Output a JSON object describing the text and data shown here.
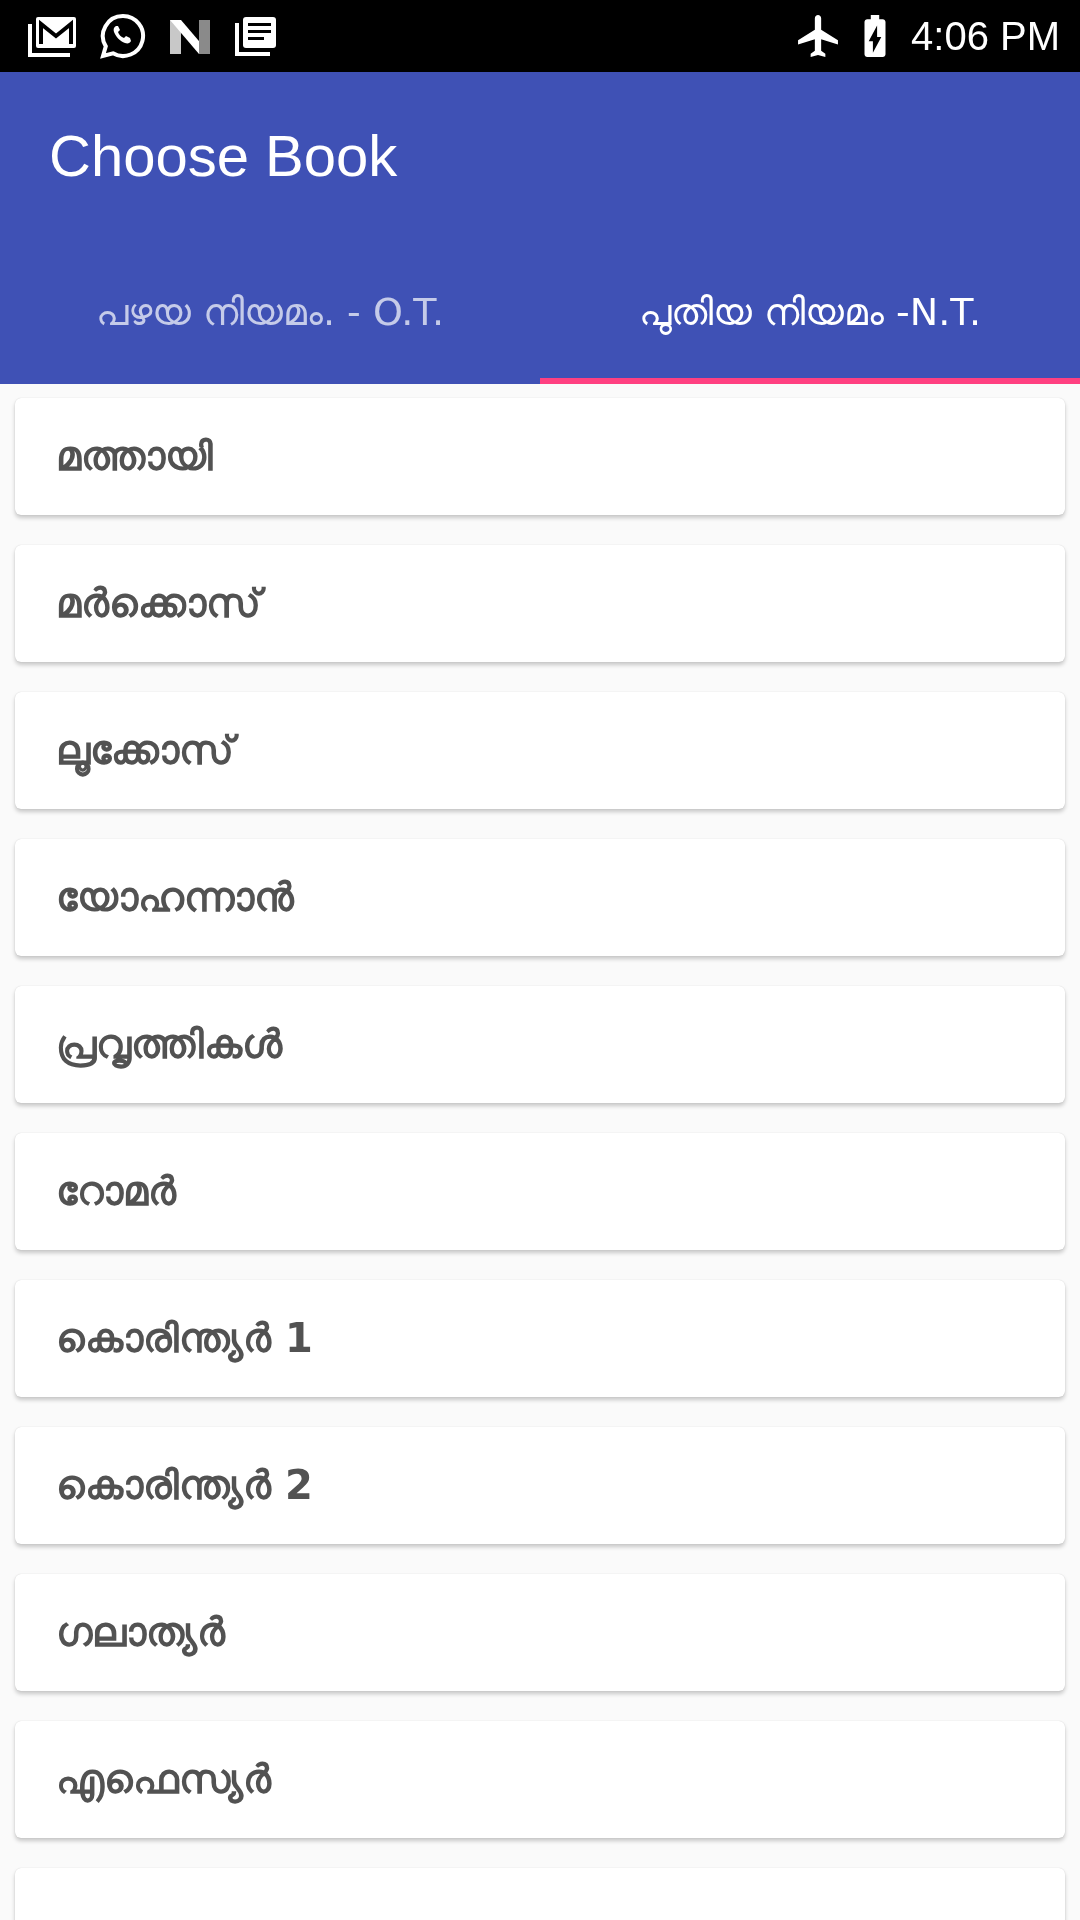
{
  "status_bar": {
    "notifications": [
      {
        "kind": "mail"
      },
      {
        "kind": "chat"
      },
      {
        "kind": "news"
      },
      {
        "kind": "document"
      }
    ],
    "airplane_mode": true,
    "battery_charging": true,
    "time": "4:06 PM"
  },
  "app_bar": {
    "title": "Choose Book"
  },
  "tabs": [
    {
      "label": "പഴയ നിയമം. - O.T.",
      "selected": false
    },
    {
      "label": "പുതിയ നിയമം -N.T.",
      "selected": true
    }
  ],
  "book_list": {
    "items": [
      "മത്തായി",
      "മർക്കൊസ്",
      "ലൂക്കോസ്",
      "യോഹന്നാൻ",
      "പ്രവൃത്തികൾ",
      "റോമർ",
      "കൊരിന്ത്യർ 1",
      "കൊരിന്ത്യർ 2",
      "ഗലാത്യർ",
      "എഫെസ്യർ"
    ],
    "more_below": true
  }
}
